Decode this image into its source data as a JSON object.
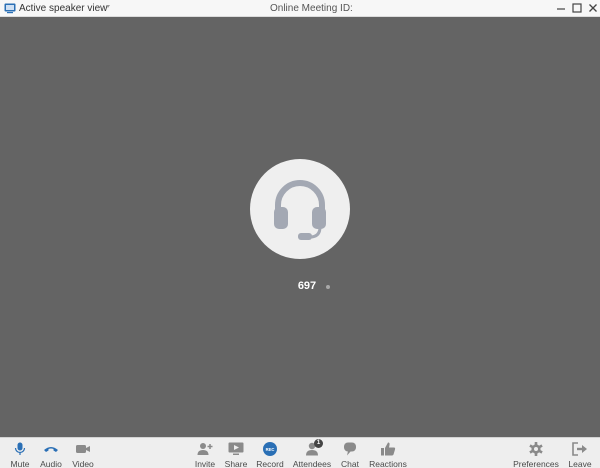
{
  "titlebar": {
    "view_title": "Active speaker view",
    "meeting_label": "Online Meeting ID:"
  },
  "stage": {
    "speaker_name": "697"
  },
  "toolbar": {
    "left": [
      {
        "label": "Mute",
        "icon": "microphone-icon"
      },
      {
        "label": "Audio",
        "icon": "phone-handset-icon"
      },
      {
        "label": "Video",
        "icon": "video-camera-icon"
      }
    ],
    "center": [
      {
        "label": "Invite",
        "icon": "add-person-icon"
      },
      {
        "label": "Share",
        "icon": "share-screen-icon"
      },
      {
        "label": "Record",
        "icon": "record-icon",
        "icon_text": "REC"
      },
      {
        "label": "Attendees",
        "icon": "person-icon",
        "badge": "1"
      },
      {
        "label": "Chat",
        "icon": "chat-bubble-icon"
      },
      {
        "label": "Reactions",
        "icon": "thumbs-up-icon"
      }
    ],
    "right": [
      {
        "label": "Preferences",
        "icon": "gear-icon"
      },
      {
        "label": "Leave",
        "icon": "leave-door-icon"
      }
    ]
  },
  "colors": {
    "stage_bg": "#646464",
    "icon_gray": "#8a8a8a",
    "accent_blue": "#2a6fb5",
    "avatar_icon": "#a3a8b3"
  }
}
